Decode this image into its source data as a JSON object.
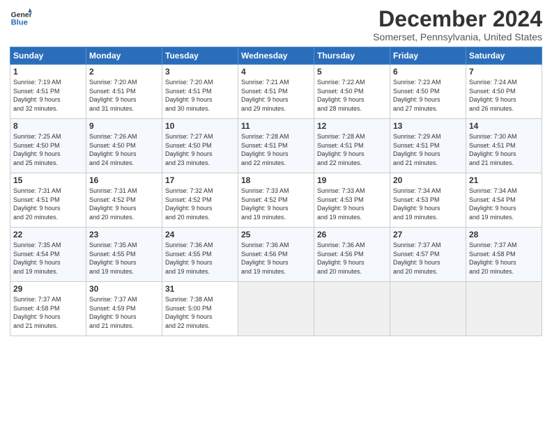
{
  "header": {
    "logo_line1": "General",
    "logo_line2": "Blue",
    "title": "December 2024",
    "subtitle": "Somerset, Pennsylvania, United States"
  },
  "days_of_week": [
    "Sunday",
    "Monday",
    "Tuesday",
    "Wednesday",
    "Thursday",
    "Friday",
    "Saturday"
  ],
  "weeks": [
    [
      {
        "day": "1",
        "info": "Sunrise: 7:19 AM\nSunset: 4:51 PM\nDaylight: 9 hours\nand 32 minutes."
      },
      {
        "day": "2",
        "info": "Sunrise: 7:20 AM\nSunset: 4:51 PM\nDaylight: 9 hours\nand 31 minutes."
      },
      {
        "day": "3",
        "info": "Sunrise: 7:20 AM\nSunset: 4:51 PM\nDaylight: 9 hours\nand 30 minutes."
      },
      {
        "day": "4",
        "info": "Sunrise: 7:21 AM\nSunset: 4:51 PM\nDaylight: 9 hours\nand 29 minutes."
      },
      {
        "day": "5",
        "info": "Sunrise: 7:22 AM\nSunset: 4:50 PM\nDaylight: 9 hours\nand 28 minutes."
      },
      {
        "day": "6",
        "info": "Sunrise: 7:23 AM\nSunset: 4:50 PM\nDaylight: 9 hours\nand 27 minutes."
      },
      {
        "day": "7",
        "info": "Sunrise: 7:24 AM\nSunset: 4:50 PM\nDaylight: 9 hours\nand 26 minutes."
      }
    ],
    [
      {
        "day": "8",
        "info": "Sunrise: 7:25 AM\nSunset: 4:50 PM\nDaylight: 9 hours\nand 25 minutes."
      },
      {
        "day": "9",
        "info": "Sunrise: 7:26 AM\nSunset: 4:50 PM\nDaylight: 9 hours\nand 24 minutes."
      },
      {
        "day": "10",
        "info": "Sunrise: 7:27 AM\nSunset: 4:50 PM\nDaylight: 9 hours\nand 23 minutes."
      },
      {
        "day": "11",
        "info": "Sunrise: 7:28 AM\nSunset: 4:51 PM\nDaylight: 9 hours\nand 22 minutes."
      },
      {
        "day": "12",
        "info": "Sunrise: 7:28 AM\nSunset: 4:51 PM\nDaylight: 9 hours\nand 22 minutes."
      },
      {
        "day": "13",
        "info": "Sunrise: 7:29 AM\nSunset: 4:51 PM\nDaylight: 9 hours\nand 21 minutes."
      },
      {
        "day": "14",
        "info": "Sunrise: 7:30 AM\nSunset: 4:51 PM\nDaylight: 9 hours\nand 21 minutes."
      }
    ],
    [
      {
        "day": "15",
        "info": "Sunrise: 7:31 AM\nSunset: 4:51 PM\nDaylight: 9 hours\nand 20 minutes."
      },
      {
        "day": "16",
        "info": "Sunrise: 7:31 AM\nSunset: 4:52 PM\nDaylight: 9 hours\nand 20 minutes."
      },
      {
        "day": "17",
        "info": "Sunrise: 7:32 AM\nSunset: 4:52 PM\nDaylight: 9 hours\nand 20 minutes."
      },
      {
        "day": "18",
        "info": "Sunrise: 7:33 AM\nSunset: 4:52 PM\nDaylight: 9 hours\nand 19 minutes."
      },
      {
        "day": "19",
        "info": "Sunrise: 7:33 AM\nSunset: 4:53 PM\nDaylight: 9 hours\nand 19 minutes."
      },
      {
        "day": "20",
        "info": "Sunrise: 7:34 AM\nSunset: 4:53 PM\nDaylight: 9 hours\nand 19 minutes."
      },
      {
        "day": "21",
        "info": "Sunrise: 7:34 AM\nSunset: 4:54 PM\nDaylight: 9 hours\nand 19 minutes."
      }
    ],
    [
      {
        "day": "22",
        "info": "Sunrise: 7:35 AM\nSunset: 4:54 PM\nDaylight: 9 hours\nand 19 minutes."
      },
      {
        "day": "23",
        "info": "Sunrise: 7:35 AM\nSunset: 4:55 PM\nDaylight: 9 hours\nand 19 minutes."
      },
      {
        "day": "24",
        "info": "Sunrise: 7:36 AM\nSunset: 4:55 PM\nDaylight: 9 hours\nand 19 minutes."
      },
      {
        "day": "25",
        "info": "Sunrise: 7:36 AM\nSunset: 4:56 PM\nDaylight: 9 hours\nand 19 minutes."
      },
      {
        "day": "26",
        "info": "Sunrise: 7:36 AM\nSunset: 4:56 PM\nDaylight: 9 hours\nand 20 minutes."
      },
      {
        "day": "27",
        "info": "Sunrise: 7:37 AM\nSunset: 4:57 PM\nDaylight: 9 hours\nand 20 minutes."
      },
      {
        "day": "28",
        "info": "Sunrise: 7:37 AM\nSunset: 4:58 PM\nDaylight: 9 hours\nand 20 minutes."
      }
    ],
    [
      {
        "day": "29",
        "info": "Sunrise: 7:37 AM\nSunset: 4:58 PM\nDaylight: 9 hours\nand 21 minutes."
      },
      {
        "day": "30",
        "info": "Sunrise: 7:37 AM\nSunset: 4:59 PM\nDaylight: 9 hours\nand 21 minutes."
      },
      {
        "day": "31",
        "info": "Sunrise: 7:38 AM\nSunset: 5:00 PM\nDaylight: 9 hours\nand 22 minutes."
      },
      null,
      null,
      null,
      null
    ]
  ]
}
